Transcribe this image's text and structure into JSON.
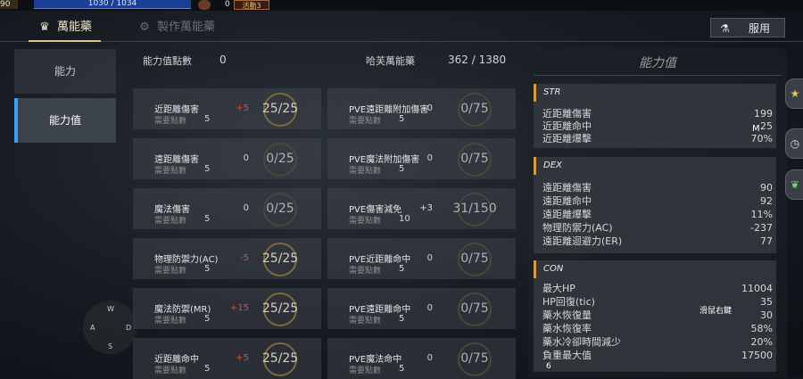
{
  "header": {
    "level": "90",
    "hp_text": "1030 / 1034",
    "currency_count": "0",
    "event_label": "活動3"
  },
  "tabs": [
    {
      "label": "萬能藥",
      "icon": "crown-icon"
    },
    {
      "label": "製作萬能藥",
      "icon": "gears-icon"
    }
  ],
  "use_button": {
    "label": "服用",
    "icon": "potion-icon"
  },
  "sidebar": {
    "items": [
      {
        "label": "能力"
      },
      {
        "label": "能力值"
      }
    ]
  },
  "summary": {
    "points_label": "能力值點數",
    "points_value": "0",
    "elixir_label": "哈芙萬能藥",
    "elixir_value": "362 / 1380"
  },
  "stat_cells": [
    {
      "name": "近距離傷害",
      "req_label": "需要點數",
      "req": "5",
      "bonus": "+5",
      "progress": "25/25"
    },
    {
      "name": "PVE遠距離附加傷害",
      "req_label": "需要點數",
      "req": "5",
      "bonus": "0",
      "progress": "0/75"
    },
    {
      "name": "遠距離傷害",
      "req_label": "需要點數",
      "req": "5",
      "bonus": "0",
      "progress": "0/25"
    },
    {
      "name": "PVE魔法附加傷害",
      "req_label": "需要點數",
      "req": "5",
      "bonus": "0",
      "progress": "0/75"
    },
    {
      "name": "魔法傷害",
      "req_label": "需要點數",
      "req": "5",
      "bonus": "0",
      "progress": "0/25"
    },
    {
      "name": "PVE傷害減免",
      "req_label": "需要點數",
      "req": "10",
      "bonus": "+3",
      "progress": "31/150"
    },
    {
      "name": "物理防禦力(AC)",
      "req_label": "需要點數",
      "req": "5",
      "bonus": "-5",
      "progress": "25/25"
    },
    {
      "name": "PVE近距離命中",
      "req_label": "需要點數",
      "req": "5",
      "bonus": "0",
      "progress": "0/75"
    },
    {
      "name": "魔法防禦(MR)",
      "req_label": "需要點數",
      "req": "5",
      "bonus": "+15",
      "progress": "25/25"
    },
    {
      "name": "PVE遠距離命中",
      "req_label": "需要點數",
      "req": "5",
      "bonus": "0",
      "progress": "0/75"
    },
    {
      "name": "近距離命中",
      "req_label": "需要點數",
      "req": "5",
      "bonus": "+5",
      "progress": "25/25"
    },
    {
      "name": "PVE魔法命中",
      "req_label": "需要點數",
      "req": "5",
      "bonus": "0",
      "progress": "0/75"
    }
  ],
  "stat_panel": {
    "title": "能力值",
    "sections": [
      {
        "name": "STR",
        "rows": [
          {
            "k": "近距離傷害",
            "v": "199"
          },
          {
            "k": "近距離命中",
            "v": "25"
          },
          {
            "k": "近距離爆擊",
            "v": "70%"
          }
        ]
      },
      {
        "name": "DEX",
        "rows": [
          {
            "k": "遠距離傷害",
            "v": "90"
          },
          {
            "k": "遠距離命中",
            "v": "92"
          },
          {
            "k": "遠距離爆擊",
            "v": "11%"
          },
          {
            "k": "物理防禦力(AC)",
            "v": "-237"
          },
          {
            "k": "遠距離迴避力(ER)",
            "v": "77"
          }
        ]
      },
      {
        "name": "CON",
        "rows": [
          {
            "k": "最大HP",
            "v": "11004"
          },
          {
            "k": "HP回復(tic)",
            "v": "35"
          },
          {
            "k": "藥水恢復量",
            "v": "30"
          },
          {
            "k": "藥水恢復率",
            "v": "58%"
          },
          {
            "k": "藥水冷卻時間減少",
            "v": "20%"
          },
          {
            "k": "負重最大值",
            "v": "17500"
          }
        ]
      }
    ]
  },
  "controls": {
    "w": "W",
    "a": "A",
    "s": "S",
    "d": "D",
    "m": "M",
    "six": "6",
    "right_click": "滑鼠右鍵"
  },
  "right_buttons": [
    {
      "icon": "star-icon"
    },
    {
      "icon": "clock-icon"
    },
    {
      "icon": "leaf-icon"
    }
  ]
}
